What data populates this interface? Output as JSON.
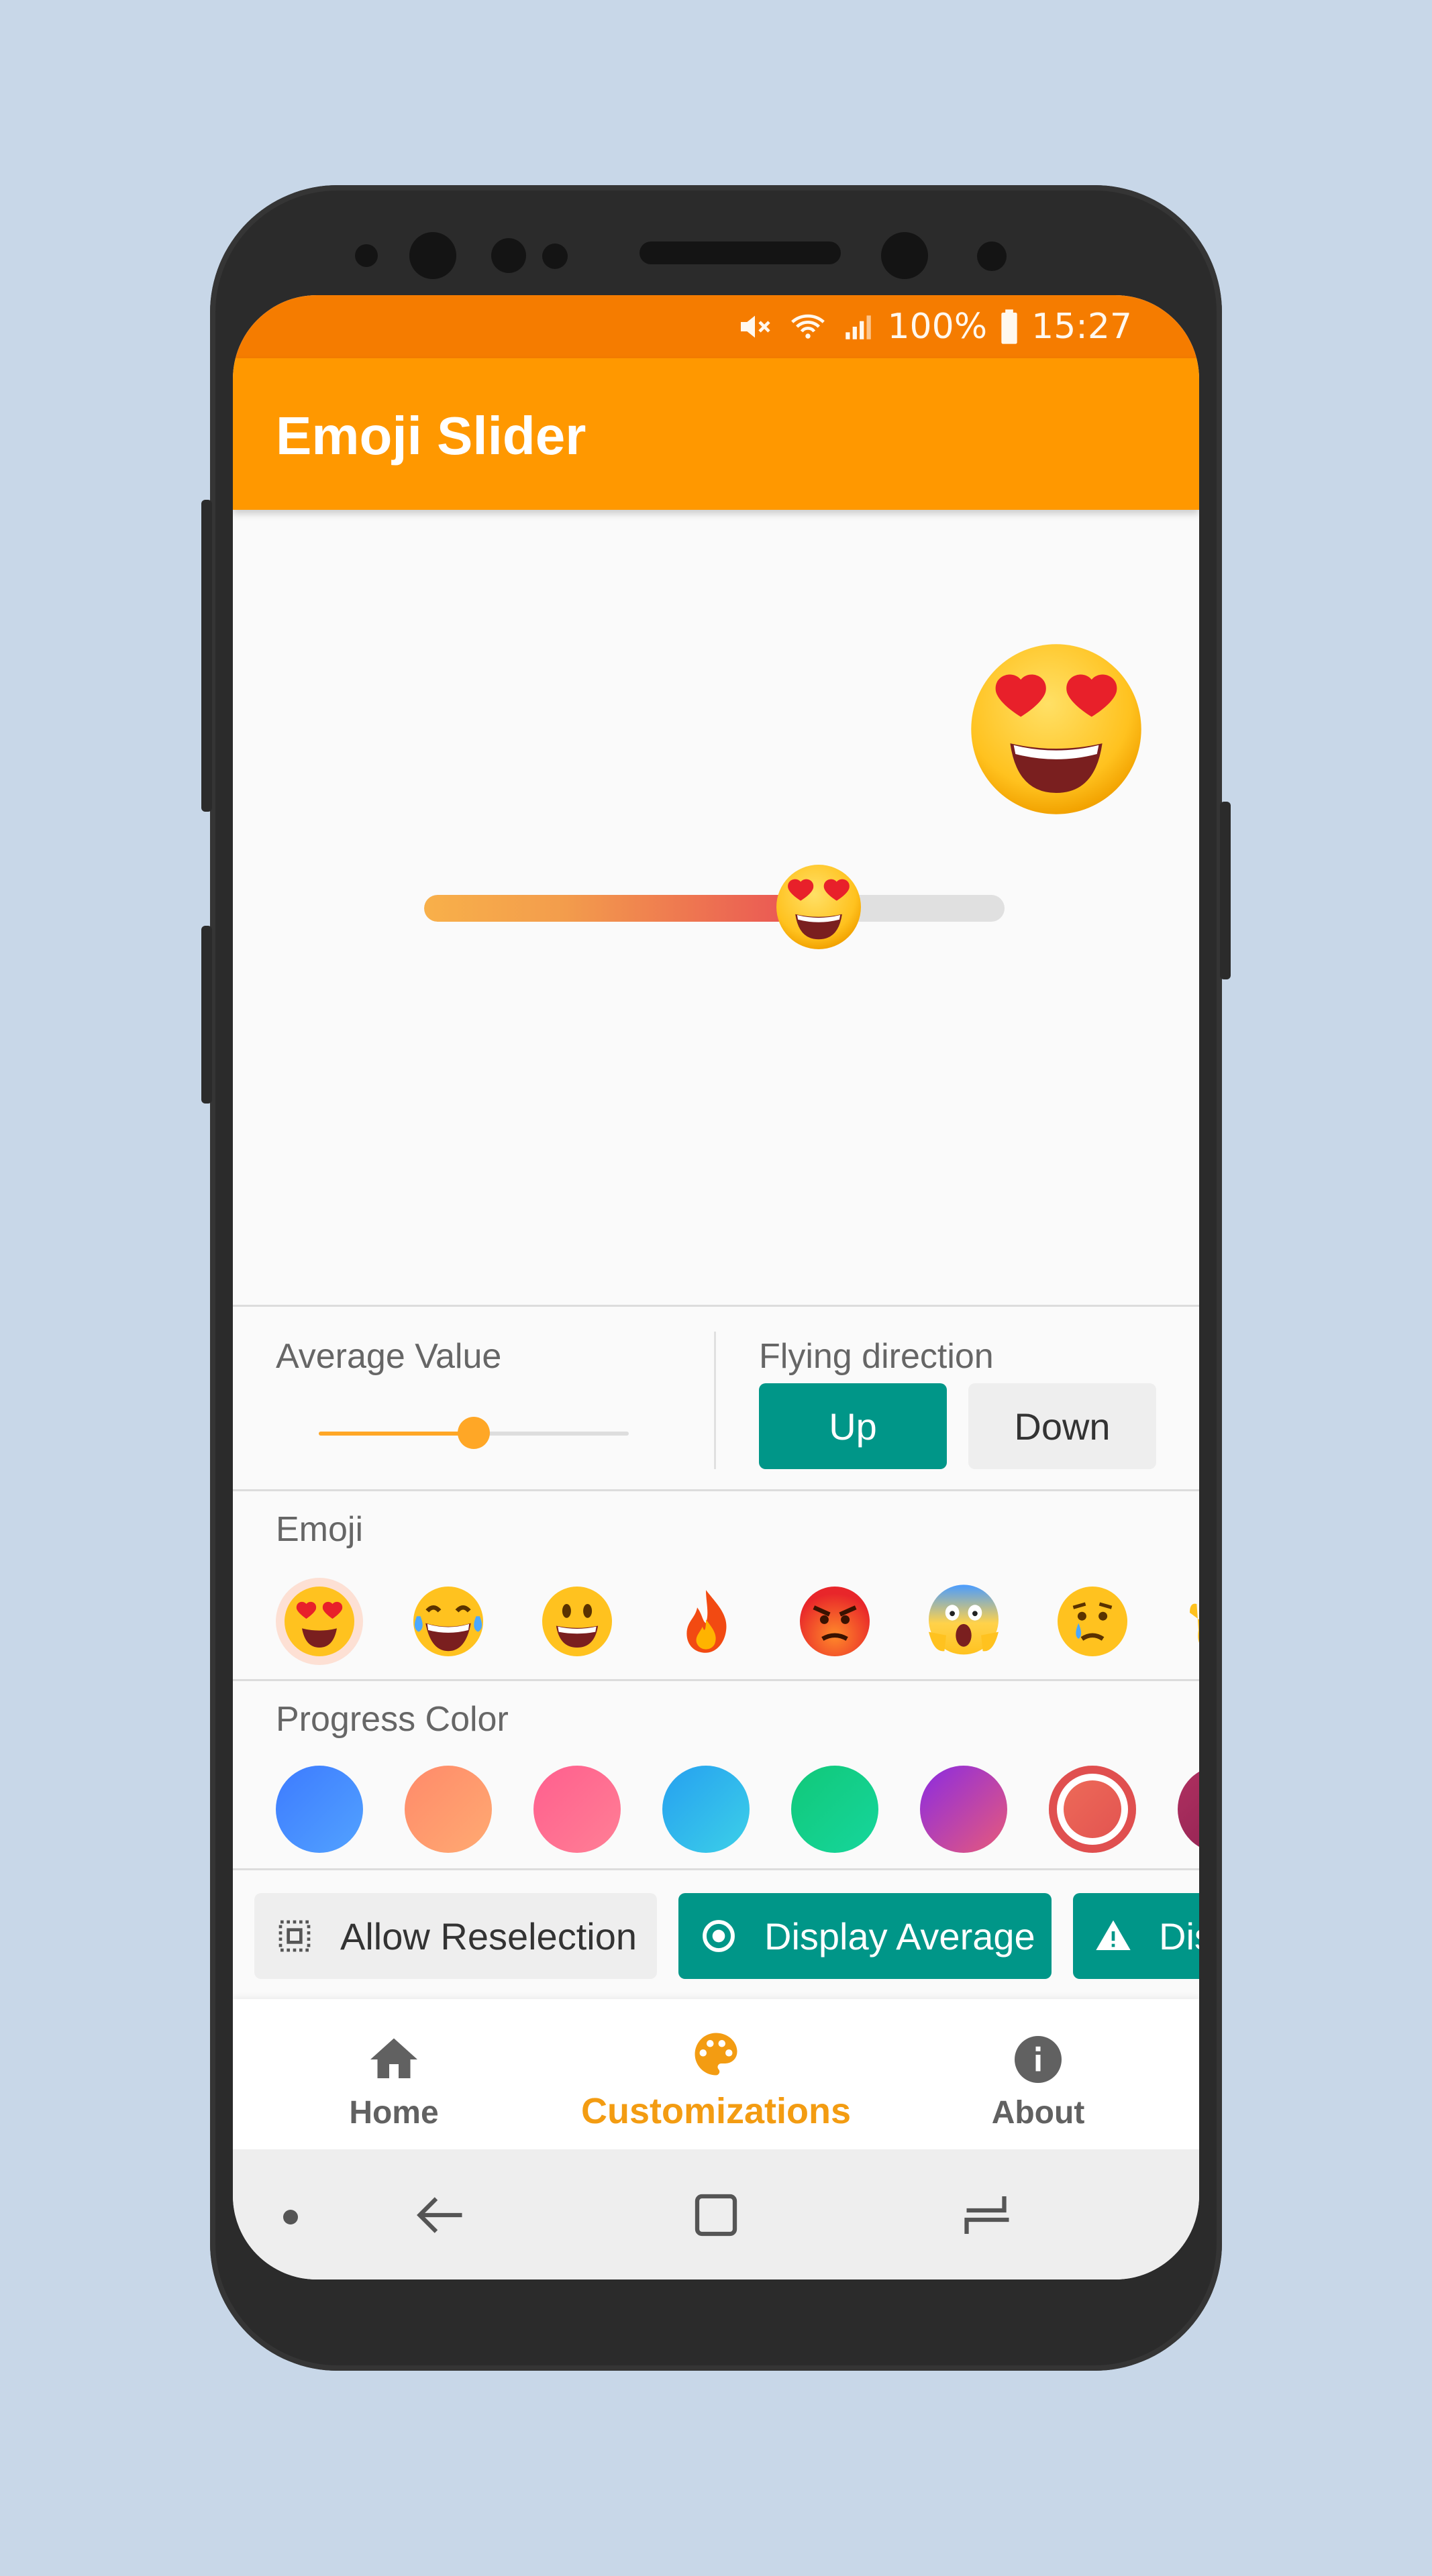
{
  "status_bar": {
    "battery": "100%",
    "time": "15:27"
  },
  "app_bar": {
    "title": "Emoji Slider"
  },
  "main_slider": {
    "value": 0.68,
    "emoji": "heart-eyes"
  },
  "average_value": {
    "label": "Average Value",
    "value": 0.5
  },
  "flying_direction": {
    "label": "Flying direction",
    "up_label": "Up",
    "down_label": "Down",
    "selected": "Up"
  },
  "emoji_section": {
    "label": "Emoji",
    "items": [
      "heart-eyes",
      "tears-of-joy",
      "grinning",
      "fire",
      "angry",
      "screaming",
      "crying",
      "raised-hand"
    ],
    "selected": "heart-eyes"
  },
  "progress_color": {
    "label": "Progress Color",
    "swatches": [
      {
        "from": "#3d7bff",
        "to": "#52a2ff"
      },
      {
        "from": "#ff8a6a",
        "to": "#ffaa72"
      },
      {
        "from": "#ff5f8e",
        "to": "#ff7f95"
      },
      {
        "from": "#26a0f0",
        "to": "#3cd0e8"
      },
      {
        "from": "#11c879",
        "to": "#16d69c"
      },
      {
        "from": "#8a2be2",
        "to": "#e85a7a"
      },
      {
        "from": "#f06f5a",
        "to": "#e04f4f"
      },
      {
        "from": "#b03060",
        "to": "#8a2050"
      }
    ],
    "selected_index": 6
  },
  "options": {
    "allow_reselection": "Allow Reselection",
    "display_average": "Display Average",
    "third_partial": "Dis"
  },
  "bottom_nav": {
    "home": "Home",
    "customizations": "Customizations",
    "about": "About",
    "selected": "Customizations"
  },
  "colors": {
    "accent": "#ff9800",
    "status": "#f57c00",
    "teal": "#009688",
    "nav_selected": "#f39c12",
    "nav_default": "#666666"
  }
}
